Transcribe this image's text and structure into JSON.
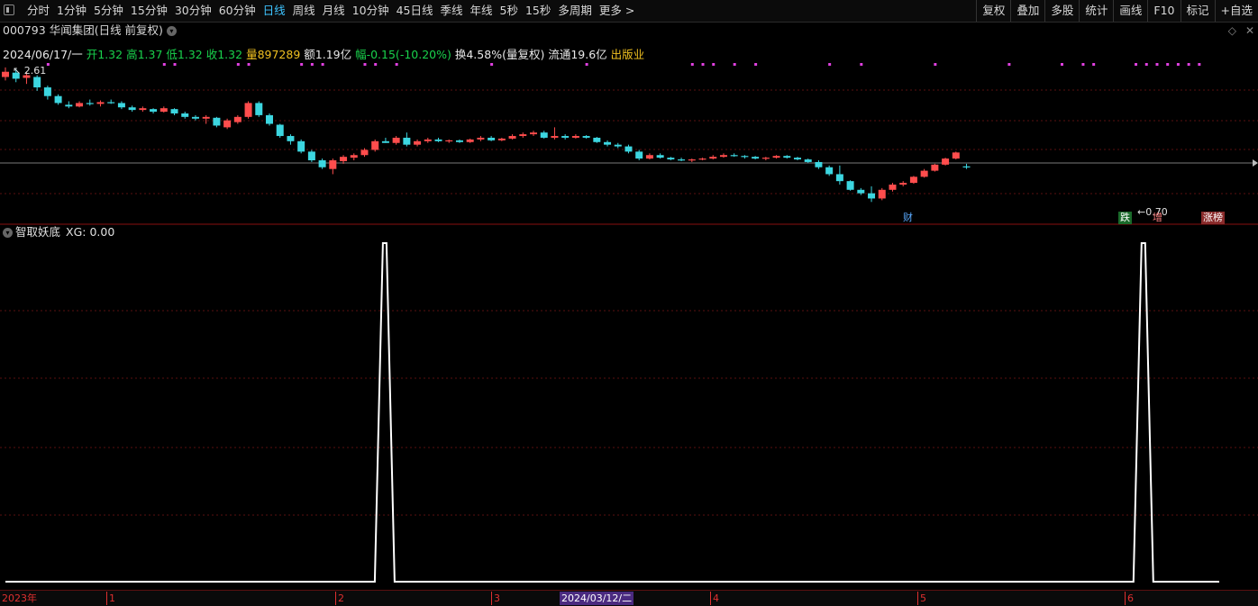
{
  "toolbar": {
    "periods": [
      "分时",
      "1分钟",
      "5分钟",
      "15分钟",
      "30分钟",
      "60分钟",
      "日线",
      "周线",
      "月线",
      "10分钟",
      "45日线",
      "季线",
      "年线",
      "5秒",
      "15秒",
      "多周期",
      "更多 >"
    ],
    "active_period": "日线",
    "right_tools": [
      "复权",
      "叠加",
      "多股",
      "统计",
      "画线",
      "F10",
      "标记",
      "+自选"
    ]
  },
  "stock": {
    "title": "000793 华闻集团(日线 前复权)"
  },
  "quote": {
    "date": "2024/06/17/一",
    "open": "开1.32",
    "high": "高1.37",
    "low": "低1.32",
    "close": "收1.32",
    "volume": "量897289",
    "amount": "额1.19亿",
    "change": "幅-0.15(-10.20%)",
    "turnover": "换4.58%(量复权)",
    "float": "流通19.6亿",
    "industry": "出版业"
  },
  "price_notes": {
    "high_label": "2.61",
    "low_label": "0.70"
  },
  "badges": {
    "fin": "财",
    "fall": "跌",
    "add": "增",
    "limit": "涨榜"
  },
  "indicator": {
    "name": "智取妖底",
    "xg": "XG: 0.00",
    "signals": [
      0,
      0,
      0,
      0,
      0,
      0,
      0,
      0,
      0,
      0,
      0,
      0,
      0,
      0,
      0,
      0,
      0,
      0,
      0,
      0,
      0,
      0,
      0,
      0,
      0,
      0,
      0,
      0,
      0,
      0,
      0,
      0,
      0,
      0,
      0,
      1,
      0,
      0,
      0,
      0,
      0,
      0,
      0,
      0,
      0,
      0,
      0,
      0,
      0,
      0,
      0,
      0,
      0,
      0,
      0,
      0,
      0,
      0,
      0,
      0,
      0,
      0,
      0,
      0,
      0,
      0,
      0,
      0,
      0,
      0,
      0,
      0,
      0,
      0,
      0,
      0,
      0,
      0,
      0,
      0,
      0,
      0,
      0,
      0,
      0,
      0,
      0,
      0,
      0,
      0,
      0,
      0,
      0,
      0,
      0,
      0,
      0,
      0,
      0,
      0,
      0,
      0,
      0,
      0,
      0,
      1,
      0,
      0,
      0,
      0,
      0,
      0,
      0
    ]
  },
  "candles": {
    "ohlc": [
      [
        2.5,
        2.61,
        2.46,
        2.56
      ],
      [
        2.55,
        2.59,
        2.44,
        2.48
      ],
      [
        2.49,
        2.56,
        2.42,
        2.52
      ],
      [
        2.5,
        2.52,
        2.34,
        2.38
      ],
      [
        2.38,
        2.4,
        2.24,
        2.28
      ],
      [
        2.28,
        2.3,
        2.18,
        2.2
      ],
      [
        2.18,
        2.22,
        2.14,
        2.16
      ],
      [
        2.16,
        2.22,
        2.15,
        2.2
      ],
      [
        2.2,
        2.24,
        2.17,
        2.19
      ],
      [
        2.19,
        2.23,
        2.16,
        2.21
      ],
      [
        2.21,
        2.24,
        2.19,
        2.2
      ],
      [
        2.2,
        2.22,
        2.13,
        2.15
      ],
      [
        2.15,
        2.17,
        2.1,
        2.12
      ],
      [
        2.12,
        2.16,
        2.1,
        2.14
      ],
      [
        2.13,
        2.14,
        2.08,
        2.1
      ],
      [
        2.1,
        2.16,
        2.09,
        2.14
      ],
      [
        2.13,
        2.14,
        2.06,
        2.08
      ],
      [
        2.08,
        2.1,
        2.02,
        2.04
      ],
      [
        2.04,
        2.06,
        2.0,
        2.02
      ],
      [
        2.02,
        2.06,
        1.96,
        2.04
      ],
      [
        2.03,
        2.04,
        1.92,
        1.94
      ],
      [
        1.92,
        2.02,
        1.9,
        2.0
      ],
      [
        1.98,
        2.06,
        1.96,
        2.04
      ],
      [
        2.04,
        2.22,
        2.02,
        2.2
      ],
      [
        2.2,
        2.22,
        2.04,
        2.06
      ],
      [
        2.06,
        2.08,
        1.94,
        1.96
      ],
      [
        1.95,
        1.96,
        1.8,
        1.82
      ],
      [
        1.82,
        1.84,
        1.72,
        1.76
      ],
      [
        1.76,
        1.78,
        1.62,
        1.64
      ],
      [
        1.64,
        1.66,
        1.52,
        1.54
      ],
      [
        1.54,
        1.56,
        1.44,
        1.46
      ],
      [
        1.44,
        1.56,
        1.38,
        1.54
      ],
      [
        1.53,
        1.6,
        1.5,
        1.58
      ],
      [
        1.57,
        1.62,
        1.54,
        1.6
      ],
      [
        1.6,
        1.68,
        1.58,
        1.66
      ],
      [
        1.66,
        1.78,
        1.64,
        1.76
      ],
      [
        1.76,
        1.8,
        1.74,
        1.74
      ],
      [
        1.74,
        1.82,
        1.72,
        1.8
      ],
      [
        1.8,
        1.86,
        1.7,
        1.72
      ],
      [
        1.72,
        1.78,
        1.7,
        1.76
      ],
      [
        1.76,
        1.8,
        1.74,
        1.78
      ],
      [
        1.78,
        1.8,
        1.75,
        1.76
      ],
      [
        1.76,
        1.78,
        1.74,
        1.77
      ],
      [
        1.77,
        1.78,
        1.74,
        1.75
      ],
      [
        1.75,
        1.79,
        1.74,
        1.78
      ],
      [
        1.78,
        1.82,
        1.76,
        1.8
      ],
      [
        1.8,
        1.82,
        1.76,
        1.77
      ],
      [
        1.77,
        1.8,
        1.76,
        1.79
      ],
      [
        1.79,
        1.84,
        1.78,
        1.82
      ],
      [
        1.82,
        1.86,
        1.8,
        1.84
      ],
      [
        1.84,
        1.88,
        1.82,
        1.86
      ],
      [
        1.86,
        1.88,
        1.79,
        1.8
      ],
      [
        1.8,
        1.92,
        1.78,
        1.82
      ],
      [
        1.82,
        1.84,
        1.78,
        1.8
      ],
      [
        1.8,
        1.84,
        1.79,
        1.82
      ],
      [
        1.82,
        1.83,
        1.79,
        1.8
      ],
      [
        1.8,
        1.81,
        1.74,
        1.75
      ],
      [
        1.75,
        1.77,
        1.7,
        1.72
      ],
      [
        1.72,
        1.74,
        1.68,
        1.7
      ],
      [
        1.7,
        1.72,
        1.62,
        1.64
      ],
      [
        1.64,
        1.66,
        1.54,
        1.56
      ],
      [
        1.56,
        1.62,
        1.55,
        1.6
      ],
      [
        1.6,
        1.62,
        1.56,
        1.57
      ],
      [
        1.57,
        1.58,
        1.54,
        1.55
      ],
      [
        1.55,
        1.57,
        1.53,
        1.54
      ],
      [
        1.54,
        1.56,
        1.52,
        1.55
      ],
      [
        1.55,
        1.57,
        1.54,
        1.56
      ],
      [
        1.56,
        1.6,
        1.55,
        1.58
      ],
      [
        1.58,
        1.62,
        1.57,
        1.6
      ],
      [
        1.6,
        1.62,
        1.58,
        1.59
      ],
      [
        1.59,
        1.6,
        1.56,
        1.58
      ],
      [
        1.58,
        1.59,
        1.55,
        1.56
      ],
      [
        1.56,
        1.58,
        1.54,
        1.57
      ],
      [
        1.57,
        1.6,
        1.56,
        1.59
      ],
      [
        1.59,
        1.6,
        1.56,
        1.57
      ],
      [
        1.57,
        1.58,
        1.54,
        1.55
      ],
      [
        1.55,
        1.56,
        1.51,
        1.52
      ],
      [
        1.52,
        1.54,
        1.44,
        1.46
      ],
      [
        1.46,
        1.48,
        1.36,
        1.38
      ],
      [
        1.38,
        1.48,
        1.26,
        1.3
      ],
      [
        1.3,
        1.31,
        1.19,
        1.2
      ],
      [
        1.2,
        1.22,
        1.14,
        1.16
      ],
      [
        1.16,
        1.24,
        1.06,
        1.1
      ],
      [
        1.1,
        1.22,
        1.08,
        1.2
      ],
      [
        1.2,
        1.28,
        1.18,
        1.26
      ],
      [
        1.26,
        1.3,
        1.24,
        1.28
      ],
      [
        1.28,
        1.36,
        1.27,
        1.35
      ],
      [
        1.35,
        1.44,
        1.34,
        1.42
      ],
      [
        1.42,
        1.5,
        1.41,
        1.49
      ],
      [
        1.49,
        1.57,
        1.48,
        1.56
      ],
      [
        1.56,
        1.64,
        1.55,
        1.63
      ],
      [
        1.47,
        1.5,
        1.44,
        1.46
      ]
    ]
  },
  "xaxis": {
    "labels": [
      "2023年",
      "1",
      "2",
      "3",
      "2024/03/12/二",
      "4",
      "5",
      "6"
    ]
  },
  "colors": {
    "up": "#ff4d4d",
    "down": "#3cd6e0",
    "signal": "#ffffff",
    "marker": "#e040e0"
  }
}
